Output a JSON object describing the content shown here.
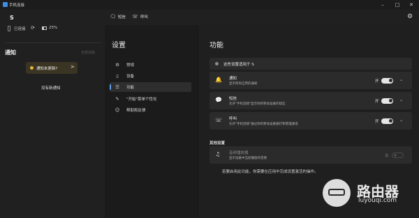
{
  "app": {
    "title": "手机连接"
  },
  "window_controls": {
    "minimize": "–",
    "maximize": "□",
    "close": "✕"
  },
  "device": {
    "name": "S",
    "status": "已连接",
    "battery": "25%"
  },
  "notifications": {
    "title": "通知",
    "clear_all": "全部清除",
    "toast_text": "通知未更新?",
    "toast_chevron": ">",
    "empty_text": "没有新通知"
  },
  "tabs": [
    {
      "icon": "chat-icon",
      "label": "短信"
    },
    {
      "icon": "phone-icon",
      "label": "呼叫"
    }
  ],
  "settings": {
    "title": "设置",
    "nav": [
      {
        "icon": "gear-icon",
        "label": "常规"
      },
      {
        "icon": "phone-icon",
        "label": "设备"
      },
      {
        "icon": "list-icon",
        "label": "功能",
        "active": true
      },
      {
        "icon": "brush-icon",
        "label": "\"开始\"菜单个性化"
      },
      {
        "icon": "people-icon",
        "label": "帮助和反馈"
      }
    ]
  },
  "features": {
    "title": "功能",
    "apply_text": "这些设置适用于 S",
    "items": [
      {
        "icon": "bell-icon",
        "title": "通知",
        "desc": "显示所有应用的通知",
        "state": "开",
        "on": true
      },
      {
        "icon": "chat-icon",
        "title": "短信",
        "desc": "允许\"手机连接\"显示你的移动设备的短信",
        "state": "开",
        "on": true
      },
      {
        "icon": "phone-icon",
        "title": "呼叫",
        "desc": "允许\"手机连接\"通过你的移动设备拨打和管理通话",
        "state": "开",
        "on": true
      }
    ],
    "other_title": "其他设置",
    "other_items": [
      {
        "icon": "music-icon",
        "title": "音频播放器",
        "desc": "显示设备中当前播放的音频",
        "state": "关",
        "on": false
      }
    ],
    "bottom_note": "若要启用此功能，你需要在应用中完成设置激活的操作。"
  },
  "watermark": {
    "text": "路由器",
    "url": "luyouqi.com"
  }
}
